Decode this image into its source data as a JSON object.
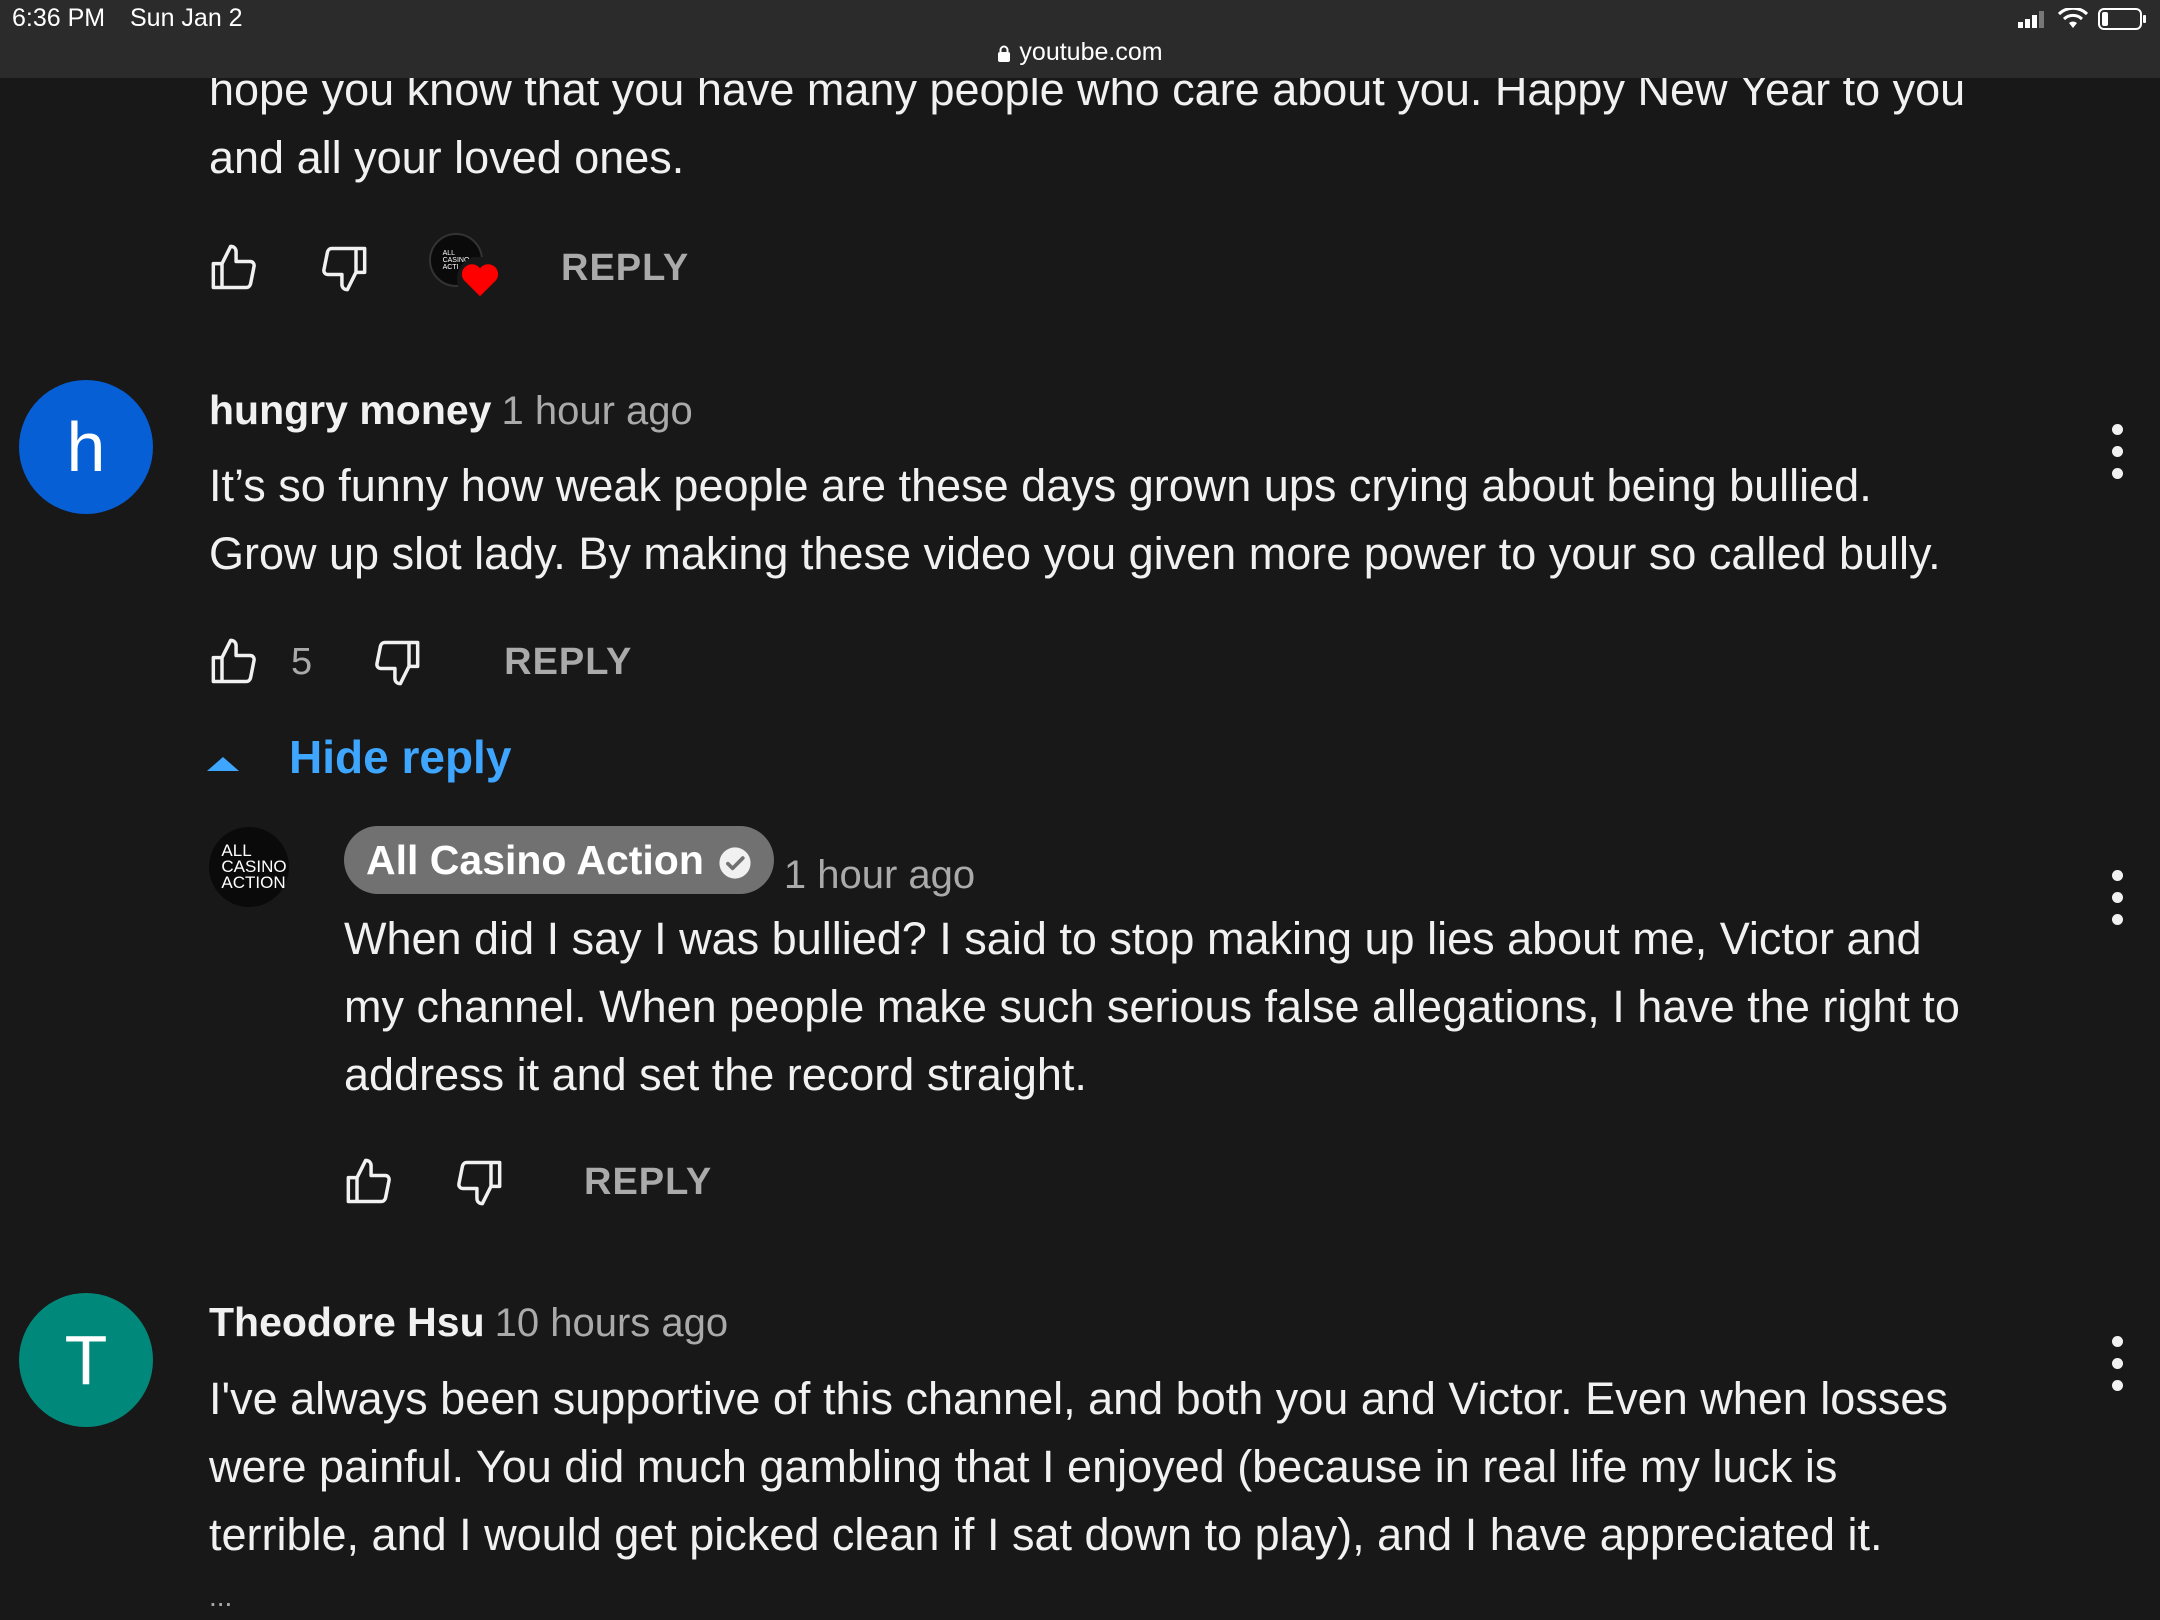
{
  "status_bar": {
    "time": "6:36 PM",
    "date": "Sun Jan 2",
    "url": "youtube.com"
  },
  "top_comment": {
    "text_line1": "hope you know that you have many people who care about you. Happy New Year to you",
    "text_line2": "and all your loved ones.",
    "reply_label": "REPLY"
  },
  "comment1": {
    "avatar_letter": "h",
    "avatar_color": "#065fd4",
    "author": "hungry money",
    "time_ago": "1 hour ago",
    "text_line1": "It’s so funny how weak people are these days grown ups crying about being bullied.",
    "text_line2": "Grow up slot lady. By making these video you given more power to your so called bully.",
    "likes": "5",
    "reply_label": "REPLY",
    "hide_reply_label": "Hide reply"
  },
  "reply1": {
    "avatar_text": [
      "ALL",
      "CASINO",
      "ACTION"
    ],
    "author": "All Casino Action",
    "time_ago": "1 hour ago",
    "text_line1": "When did I say I was bullied? I said to stop making up lies about me, Victor and",
    "text_line2": "my channel. When people make such serious false allegations, I have the right to",
    "text_line3": "address it and set the record straight.",
    "reply_label": "REPLY"
  },
  "comment2": {
    "avatar_letter": "T",
    "avatar_color": "#00897b",
    "author": "Theodore Hsu",
    "time_ago": "10 hours ago",
    "text_line1": "I've always been supportive of this channel, and both you and Victor.  Even when losses",
    "text_line2": "were painful.  You did much gambling that I enjoyed (because in real life my luck is",
    "text_line3": "terrible, and I would get picked clean if I sat down to play), and I have appreciated it.",
    "ellipsis": "..."
  },
  "icons": {
    "like": "thumbs-up-icon",
    "dislike": "thumbs-down-icon",
    "heart": "heart-icon",
    "more": "more-vertical-icon",
    "verified": "verified-check-icon",
    "lock": "lock-icon"
  },
  "colors": {
    "background": "#181818",
    "link_blue": "#3ea6ff",
    "heart_red": "#ff0000"
  }
}
